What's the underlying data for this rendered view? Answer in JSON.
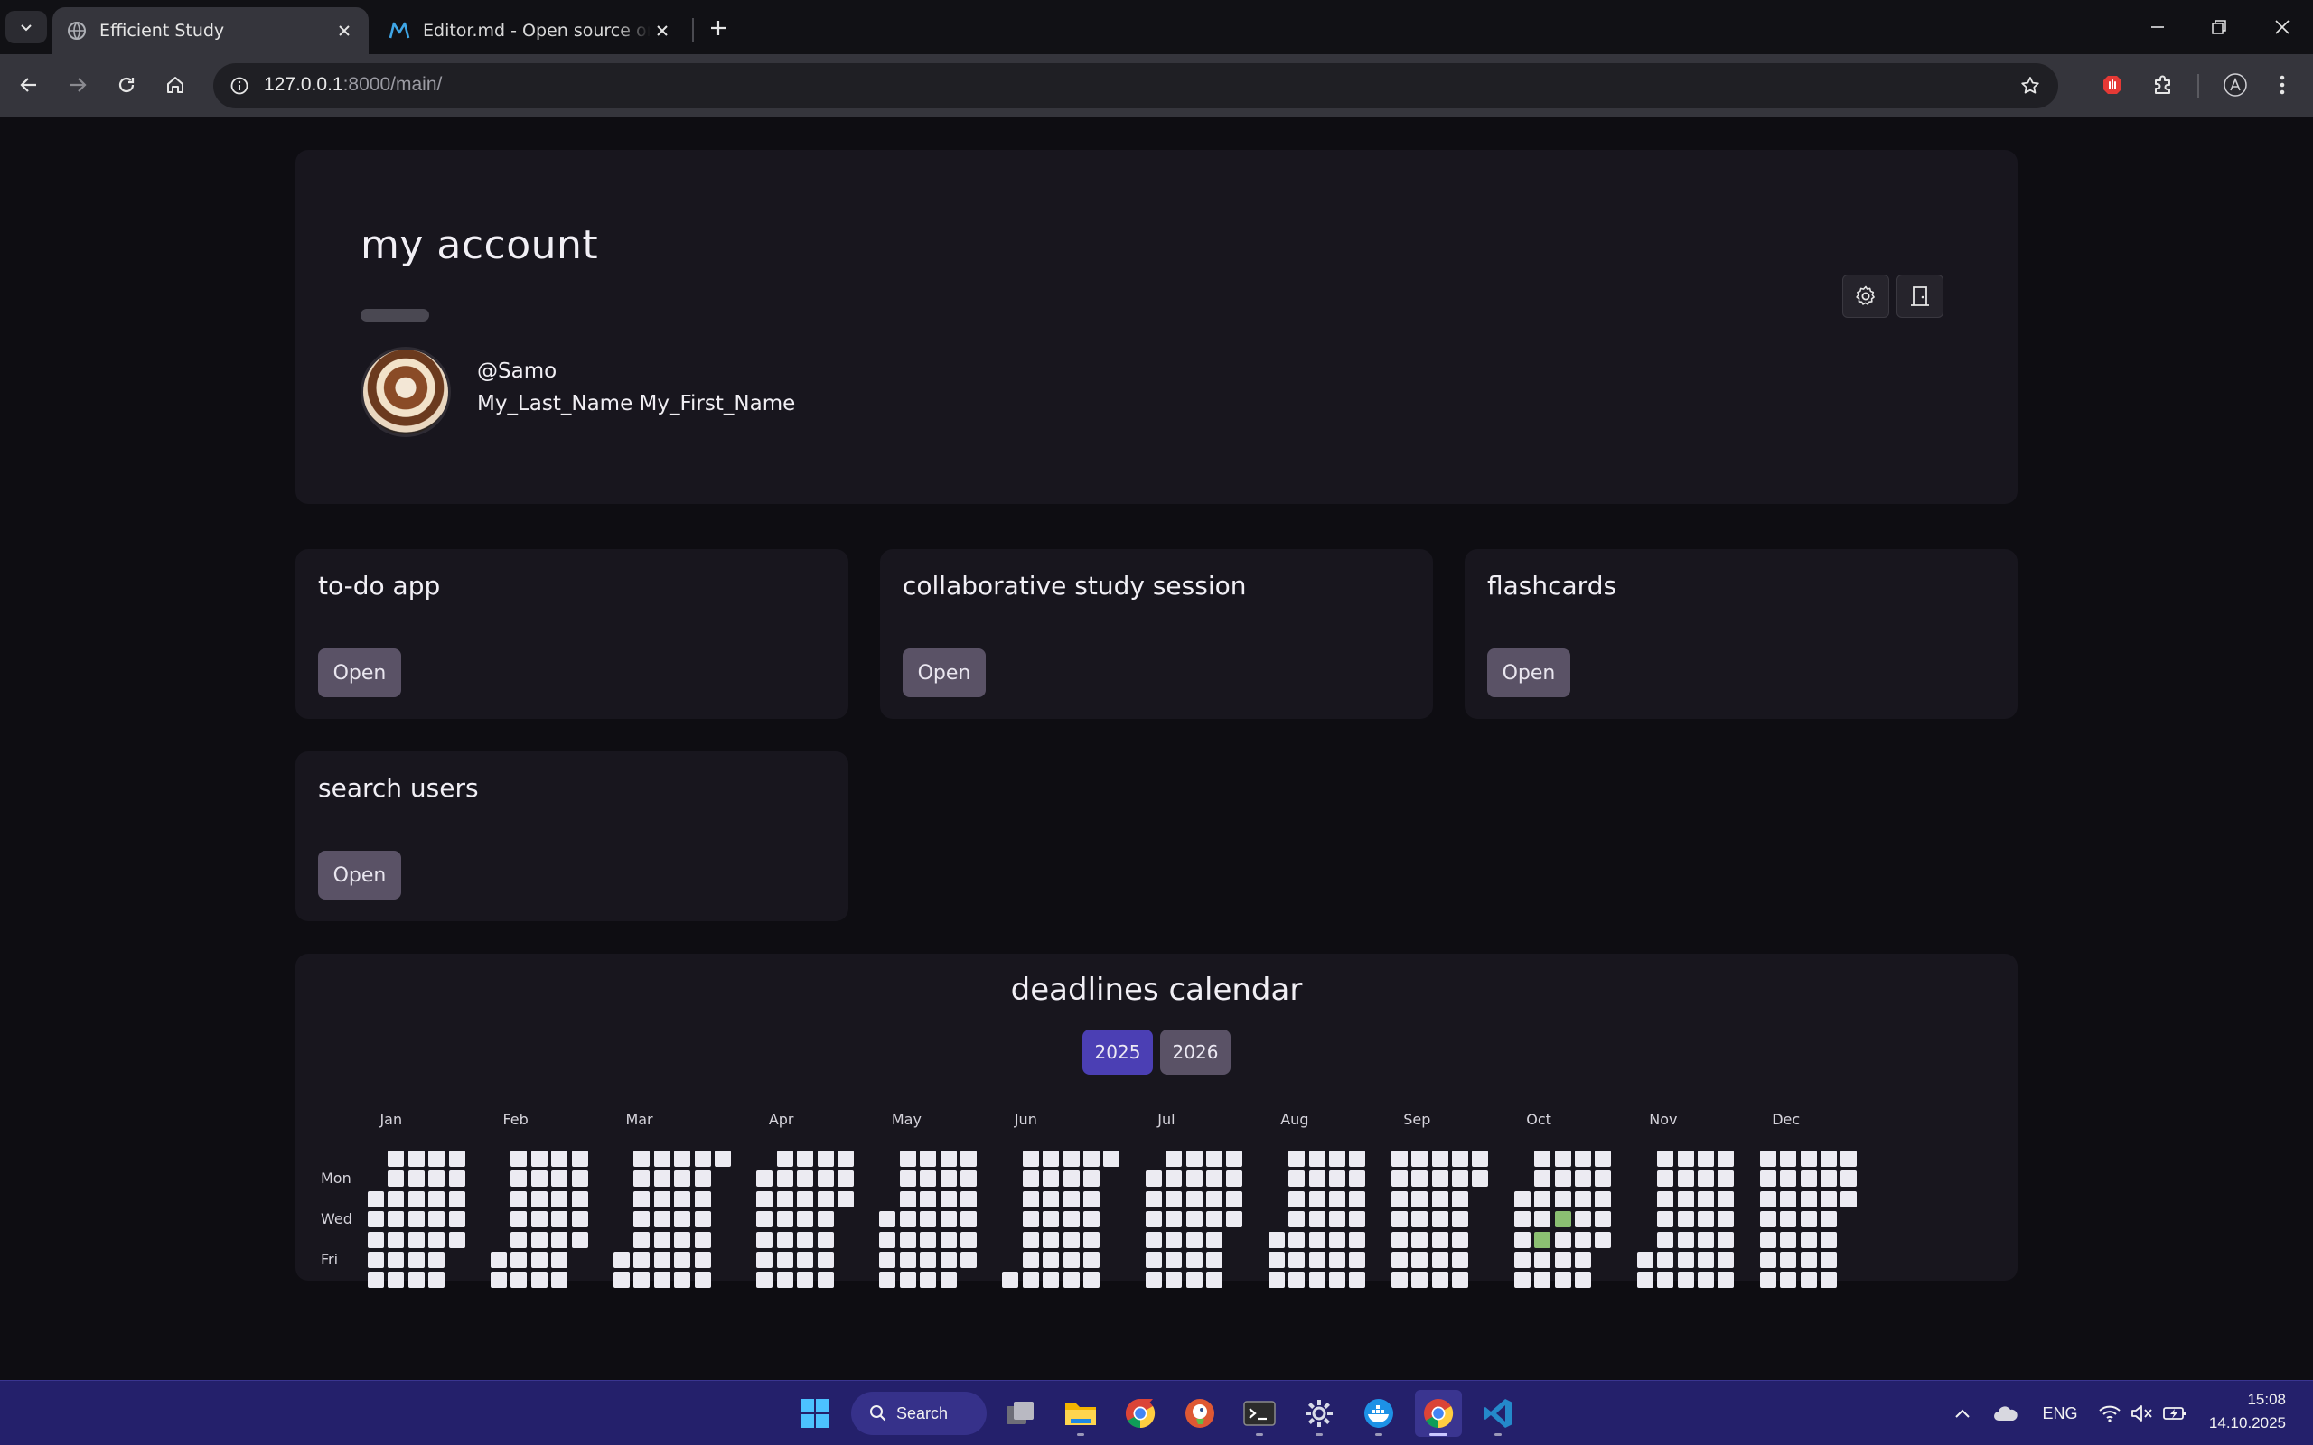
{
  "browser": {
    "tabs": [
      {
        "title": "Efficient Study",
        "active": true
      },
      {
        "title": "Editor.md - Open source online",
        "active": false
      }
    ],
    "url_host": "127.0.0.1",
    "url_path": ":8000/main/"
  },
  "account": {
    "title": "my account",
    "username": "@Samo",
    "full_name": "My_Last_Name My_First_Name"
  },
  "apps": [
    {
      "title": "to-do app",
      "button": "Open"
    },
    {
      "title": "collaborative study session",
      "button": "Open"
    },
    {
      "title": "flashcards",
      "button": "Open"
    },
    {
      "title": "search users",
      "button": "Open"
    }
  ],
  "calendar": {
    "title": "deadlines calendar",
    "years": [
      "2025",
      "2026"
    ],
    "selected_year": "2025",
    "months": [
      "Jan",
      "Feb",
      "Mar",
      "Apr",
      "May",
      "Jun",
      "Jul",
      "Aug",
      "Sep",
      "Oct",
      "Nov",
      "Dec"
    ],
    "day_labels": [
      "Mon",
      "Wed",
      "Fri"
    ],
    "highlighted_dates": [
      "2025-10-10",
      "2025-10-16"
    ],
    "colors": {
      "empty": "#ecebf2",
      "deadline": "#8bbf72",
      "year_selected": "#4b3fb4",
      "year_other": "#5a5266"
    }
  },
  "taskbar": {
    "search_label": "Search",
    "language": "ENG",
    "time": "15:08",
    "date": "14.10.2025"
  }
}
